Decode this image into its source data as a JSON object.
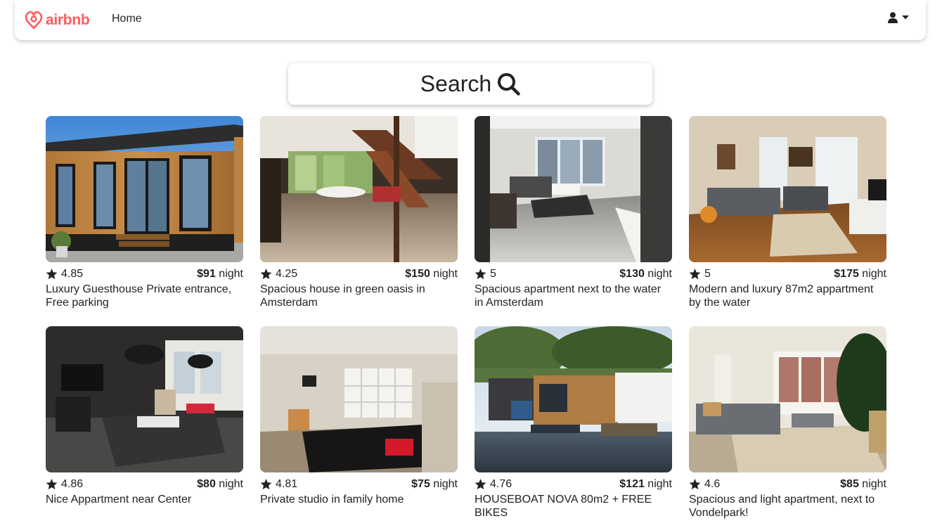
{
  "nav": {
    "logo_text": "airbnb",
    "home_label": "Home",
    "brand_color": "#ff5a5f",
    "user_icon": "user-icon",
    "dropdown_icon": "caret-down-icon"
  },
  "search": {
    "label": "Search",
    "icon": "search-icon"
  },
  "listings": [
    {
      "rating": "4.85",
      "price": "$91",
      "unit": " night",
      "title": "Luxury Guesthouse Private entrance, Free parking"
    },
    {
      "rating": "4.25",
      "price": "$150",
      "unit": " night",
      "title": "Spacious house in green oasis in Amsterdam"
    },
    {
      "rating": "5",
      "price": "$130",
      "unit": " night",
      "title": "Spacious apartment next to the water in Amsterdam"
    },
    {
      "rating": "5",
      "price": "$175",
      "unit": " night",
      "title": "Modern and luxury 87m2 appartment by the water"
    },
    {
      "rating": "4.86",
      "price": "$80",
      "unit": " night",
      "title": "Nice Appartment near Center"
    },
    {
      "rating": "4.81",
      "price": "$75",
      "unit": " night",
      "title": "Private studio in family home"
    },
    {
      "rating": "4.76",
      "price": "$121",
      "unit": " night",
      "title": "HOUSEBOAT NOVA 80m2 + FREE BIKES"
    },
    {
      "rating": "4.6",
      "price": "$85",
      "unit": " night",
      "title": "Spacious and light apartment, next to Vondelpark!"
    }
  ]
}
